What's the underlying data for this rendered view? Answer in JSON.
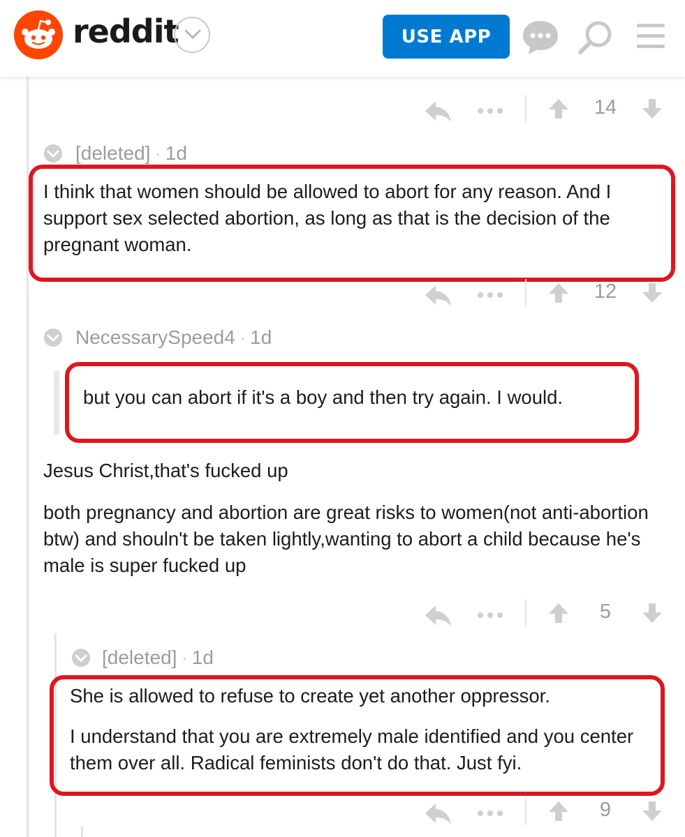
{
  "header": {
    "logo_text": "reddit",
    "use_app_label": "USE APP"
  },
  "comments": [
    {
      "score": "14"
    },
    {
      "author": "[deleted]",
      "age": "1d",
      "text": "I think that women should be allowed to abort for any reason. And I support sex selected abortion, as long as that is the decision of the pregnant woman.",
      "score": "12"
    },
    {
      "author": "NecessarySpeed4",
      "age": "1d",
      "quote": "but you can abort if it's a boy and then try again. I would.",
      "paragraphs": [
        "Jesus Christ,that's fucked up",
        "both pregnancy and abortion are great risks to women(not anti-abortion btw) and shouln't be taken lightly,wanting to abort a child because he's male is super fucked up"
      ],
      "score": "5"
    },
    {
      "author": "[deleted]",
      "age": "1d",
      "paragraphs": [
        "She is allowed to refuse to create yet another oppressor.",
        "I understand that you are extremely male identified and you center them over all. Radical feminists don't do that. Just fyi."
      ],
      "score": "9"
    }
  ],
  "colors": {
    "brand_orange": "#ff4500",
    "use_app_blue": "#0079d3",
    "highlight_red": "#e0151d",
    "meta_gray": "#9c9c9c"
  },
  "icons": [
    "reddit-logo-icon",
    "chevron-down-icon",
    "chat-icon",
    "search-icon",
    "menu-icon",
    "reply-icon",
    "more-icon",
    "upvote-icon",
    "downvote-icon",
    "collapse-icon"
  ]
}
